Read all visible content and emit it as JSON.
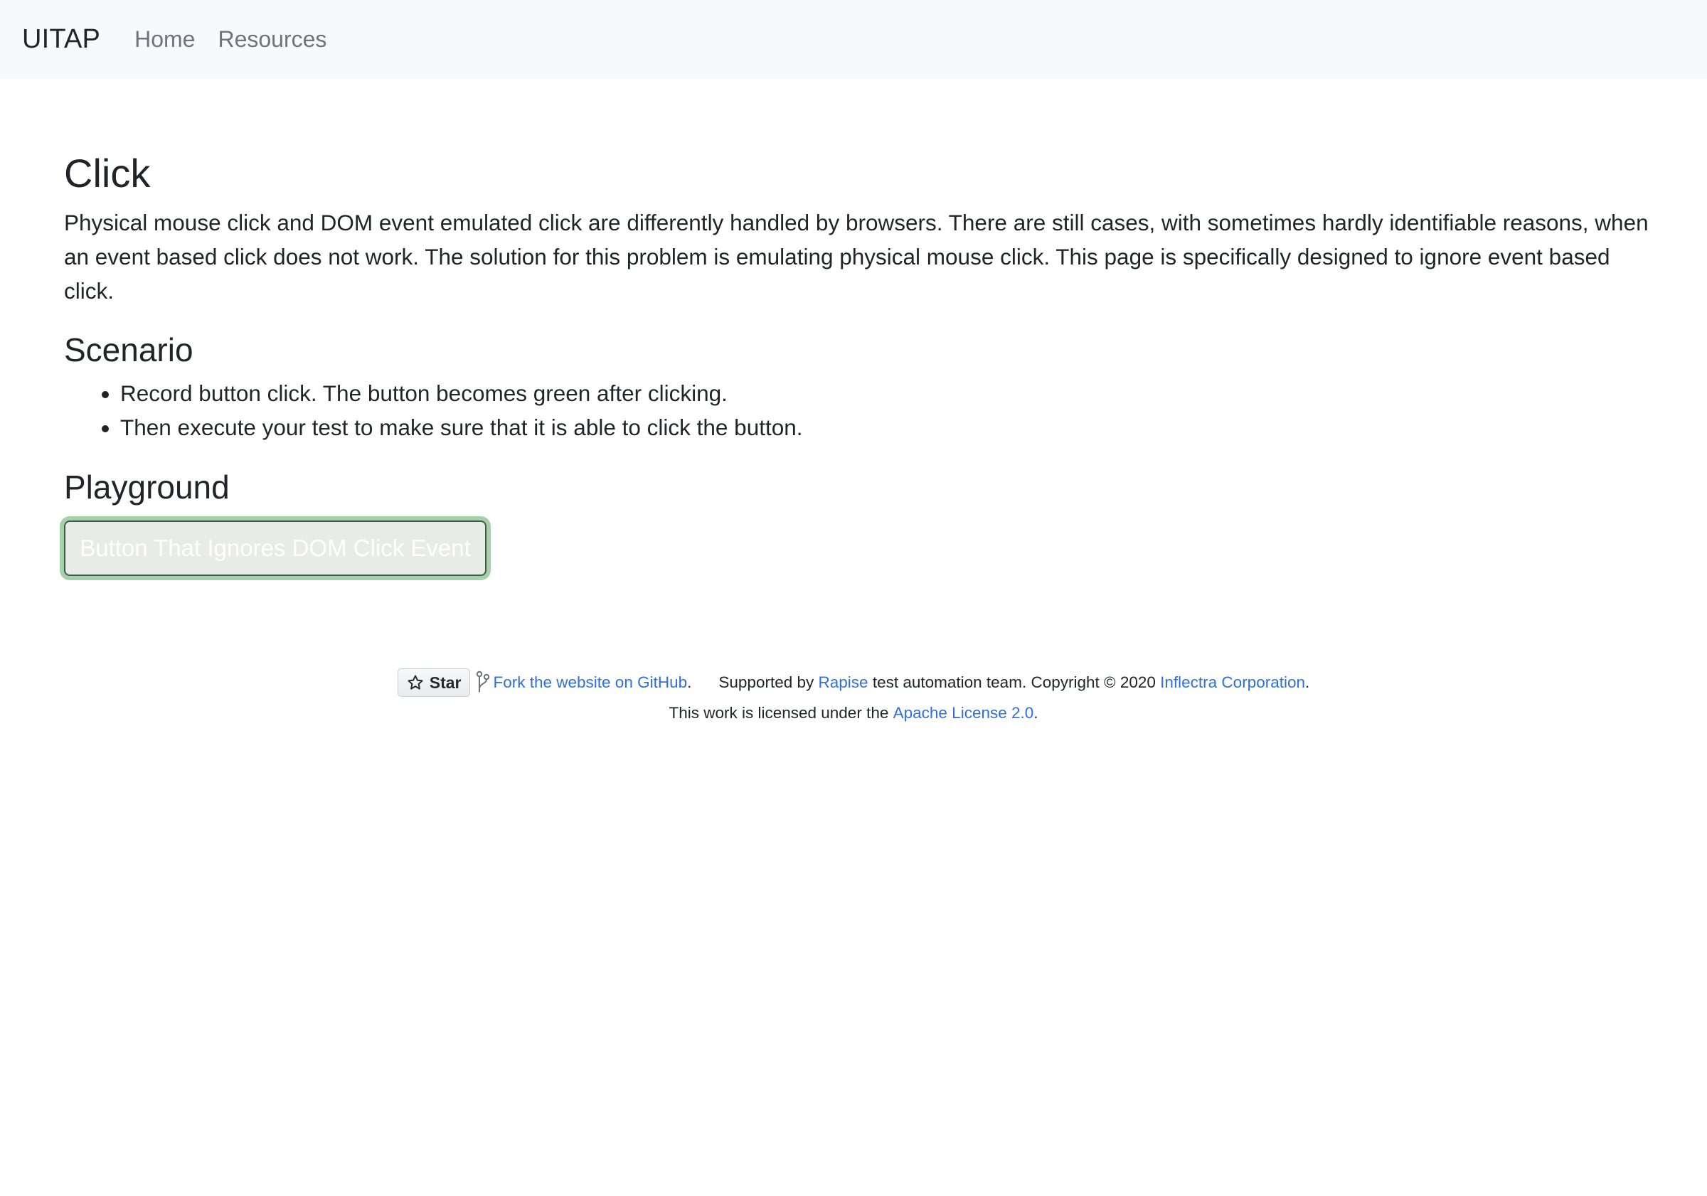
{
  "nav": {
    "brand": "UITAP",
    "links": [
      "Home",
      "Resources"
    ]
  },
  "main": {
    "title": "Click",
    "description": "Physical mouse click and DOM event emulated click are differently handled by browsers. There are still cases, with sometimes hardly identifiable reasons, when an event based click does not work. The solution for this problem is emulating physical mouse click. This page is specifically designed to ignore event based click.",
    "scenario_heading": "Scenario",
    "scenario_items": [
      "Record button click. The button becomes green after clicking.",
      "Then execute your test to make sure that it is able to click the button."
    ],
    "playground_heading": "Playground",
    "button_label": "Button That Ignores DOM Click Event"
  },
  "footer": {
    "star_label": "Star",
    "fork_link": "Fork the website on GitHub",
    "period": ".",
    "supported_by": "Supported by",
    "rapise_link": "Rapise",
    "team_text": "test automation team. Copyright © 2020",
    "inflectra_link": "Inflectra Corporation",
    "license_prefix": "This work is licensed under the",
    "license_link": "Apache License 2.0"
  },
  "colors": {
    "navbar_bg": "#f8f9fa",
    "link": "#2f6fde",
    "button_focus_ring": "#5caa64"
  },
  "icons": [
    "star-icon",
    "fork-icon"
  ]
}
